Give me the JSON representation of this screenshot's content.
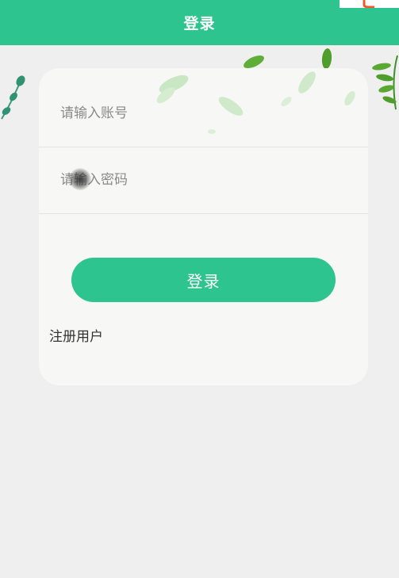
{
  "header": {
    "title": "登录"
  },
  "form": {
    "account_placeholder": "请输入账号",
    "password_placeholder": "请输入密码",
    "login_label": "登录",
    "register_label": "注册用户"
  },
  "colors": {
    "accent": "#2ec48f",
    "background": "#efefef",
    "card": "#f7f7f6",
    "text": "#333333",
    "placeholder": "#8a8a8a"
  },
  "icons": {
    "decoration": "leaf-icon",
    "corner": "app-logo-icon"
  }
}
